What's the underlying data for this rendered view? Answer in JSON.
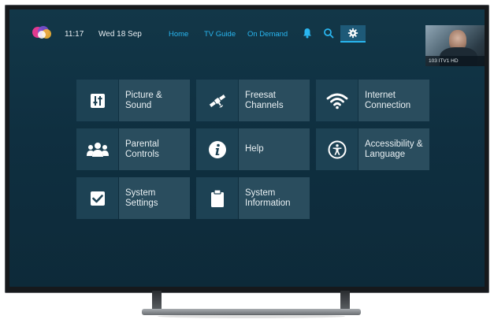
{
  "header": {
    "time": "11:17",
    "date": "Wed 18 Sep",
    "nav": [
      {
        "label": "Home"
      },
      {
        "label": "TV Guide"
      },
      {
        "label": "On Demand"
      }
    ],
    "icons": [
      "bell-icon",
      "search-icon",
      "gear-icon"
    ],
    "active_tab": "settings",
    "accent_color": "#29b6f0"
  },
  "preview": {
    "channel_label": "103 ITV1 HD"
  },
  "tiles": [
    {
      "line1": "Picture &",
      "line2": "Sound",
      "icon": "sliders-icon"
    },
    {
      "line1": "Freesat",
      "line2": "Channels",
      "icon": "satellite-icon"
    },
    {
      "line1": "Internet",
      "line2": "Connection",
      "icon": "wifi-icon"
    },
    {
      "line1": "Parental",
      "line2": "Controls",
      "icon": "people-icon"
    },
    {
      "line1": "Help",
      "line2": "",
      "icon": "info-icon"
    },
    {
      "line1": "Accessibility &",
      "line2": "Language",
      "icon": "accessibility-icon"
    },
    {
      "line1": "System",
      "line2": "Settings",
      "icon": "checkbox-icon"
    },
    {
      "line1": "System",
      "line2": "Information",
      "icon": "clipboard-icon"
    }
  ]
}
